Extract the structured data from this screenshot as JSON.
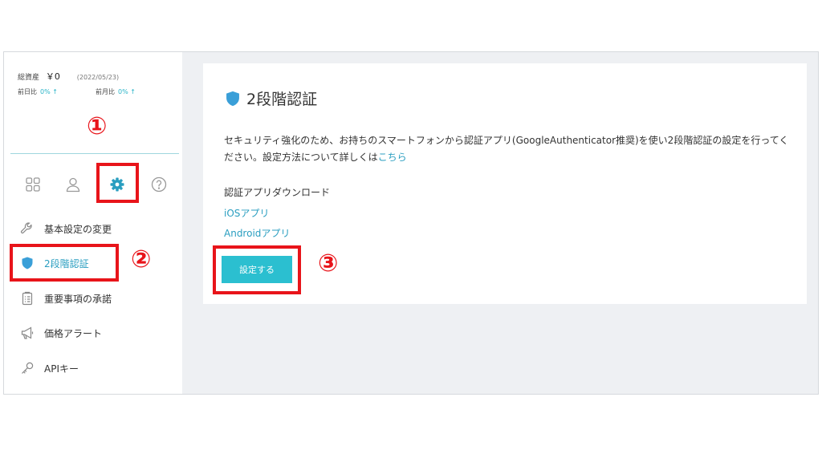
{
  "assets": {
    "total_label": "総資産",
    "total_value": "￥0",
    "date": "(2022/05/23)",
    "day_label": "前日比",
    "day_value": "0% ↑",
    "month_label": "前月比",
    "month_value": "0% ↑"
  },
  "icon_tabs": [
    {
      "name": "dashboard-grid-icon"
    },
    {
      "name": "user-icon"
    },
    {
      "name": "gear-icon",
      "active": true
    },
    {
      "name": "help-icon"
    }
  ],
  "menu": {
    "items": [
      {
        "label": "基本設定の変更",
        "icon": "wrench-icon"
      },
      {
        "label": "2段階認証",
        "icon": "shield-icon",
        "active": true
      },
      {
        "label": "重要事項の承諾",
        "icon": "clipboard-icon"
      },
      {
        "label": "価格アラート",
        "icon": "megaphone-icon"
      },
      {
        "label": "APIキー",
        "icon": "key-icon"
      }
    ]
  },
  "main": {
    "title": "2段階認証",
    "description": "セキュリティ強化のため、お持ちのスマートフォンから認証アプリ(GoogleAuthenticator推奨)を使い2段階認証の設定を行ってください。設定方法について詳しくは",
    "description_link": "こちら",
    "download_title": "認証アプリダウンロード",
    "ios_link": "iOSアプリ",
    "android_link": "Androidアプリ",
    "setup_button": "設定する"
  },
  "annotations": {
    "step1": "①",
    "step2": "②",
    "step3": "③"
  },
  "colors": {
    "accent": "#2bbfd0",
    "link": "#2a9ec0",
    "highlight": "#e8141a"
  }
}
